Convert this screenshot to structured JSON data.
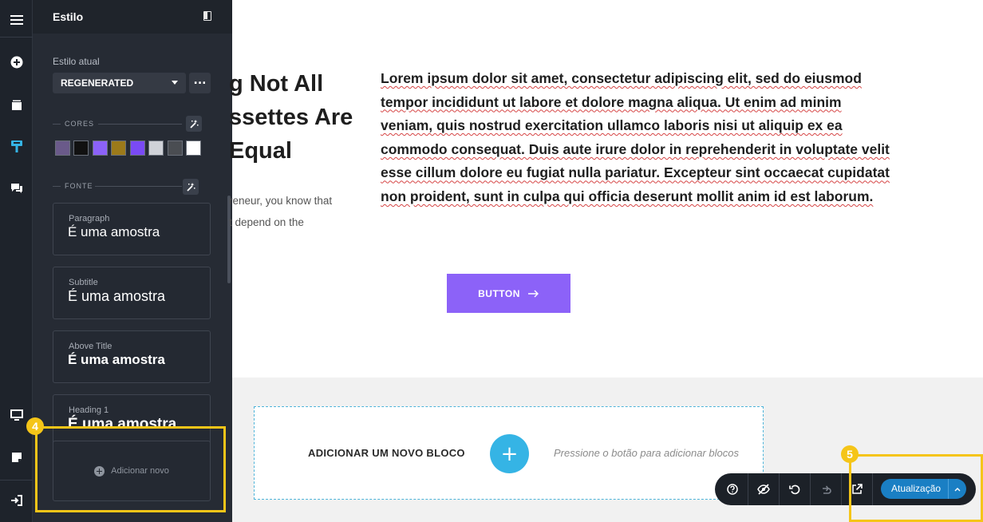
{
  "rail": {
    "icons": [
      "menu-icon",
      "add-icon",
      "pages-icon",
      "style-icon",
      "comments-icon",
      "desktop-icon",
      "notes-icon",
      "exit-icon"
    ]
  },
  "panel": {
    "title": "Estilo",
    "current_style_label": "Estilo atual",
    "current_style_value": "REGENERATED",
    "more_label": "...",
    "colors_label": "CORES",
    "colors": [
      "#6a5a8a",
      "#111111",
      "#8c62f8",
      "#9c7a1a",
      "#7a4af5",
      "#cfd2d8",
      "#4a4d52",
      "#ffffff"
    ],
    "font_label": "FONTE",
    "font_cards": [
      {
        "label": "Paragraph",
        "sample": "É uma amostra"
      },
      {
        "label": "Subtitle",
        "sample": "É uma amostra"
      },
      {
        "label": "Above Title",
        "sample": "É uma amostra"
      },
      {
        "label": "Heading 1",
        "sample": "É uma amostra"
      }
    ],
    "add_new_label": "Adicionar novo"
  },
  "canvas": {
    "heading": "g Not All\nssettes Are\nEqual",
    "body_small": "reneur, you know that\nt depend on the",
    "lorem": "Lorem ipsum dolor sit amet, consectetur adipiscing elit, sed do eiusmod tempor incididunt ut labore et dolore magna aliqua. Ut enim ad minim veniam, quis nostrud exercitation ullamco laboris nisi ut aliquip ex ea commodo consequat. Duis aute irure dolor in reprehenderit in voluptate velit esse cillum dolore eu fugiat nulla pariatur. Excepteur sint occaecat cupidatat non proident, sunt in culpa qui officia deserunt mollit anim id est laborum.",
    "button_label": "BUTTON",
    "add_block": {
      "title": "ADICIONAR UM NOVO BLOCO",
      "plus": "+",
      "hint": "Pressione o botão para adicionar blocos"
    }
  },
  "toolbar": {
    "icons": [
      "help-icon",
      "hide-icon",
      "undo-icon",
      "redo-icon",
      "preview-icon"
    ],
    "publish_label": "Atualização"
  },
  "callouts": {
    "badge_4": "4",
    "badge_5": "5"
  }
}
